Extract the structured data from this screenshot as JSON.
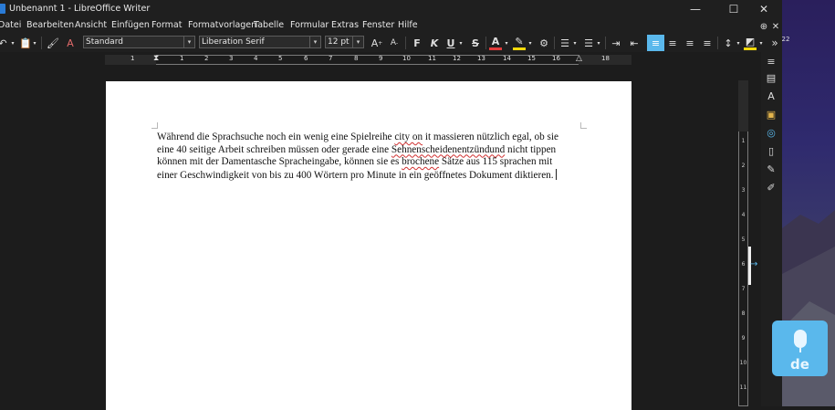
{
  "window": {
    "title": "Unbenannt 1 - LibreOffice Writer",
    "controls": [
      "—",
      "☐",
      "✕"
    ]
  },
  "menu": {
    "items": [
      "Datei",
      "Bearbeiten",
      "Ansicht",
      "Einfügen",
      "Format",
      "Formatvorlagen",
      "Tabelle",
      "Formular",
      "Extras",
      "Fenster",
      "Hilfe"
    ]
  },
  "toolbar": {
    "paragraph_style": "Standard",
    "font_name": "Liberation Serif",
    "font_size": "12 pt",
    "bold_label": "F",
    "italic_label": "K",
    "underline_label": "U",
    "strikethrough_label": "S",
    "overflow_label": "»",
    "overflow_number": "22"
  },
  "ruler": {
    "labels": [
      "1",
      "1",
      "2",
      "3",
      "4",
      "5",
      "6",
      "7",
      "8",
      "9",
      "10",
      "11",
      "12",
      "13",
      "14",
      "15",
      "16",
      "17",
      "18"
    ]
  },
  "vertical_ruler": {
    "labels": [
      "1",
      "2",
      "3",
      "4",
      "5",
      "6",
      "7",
      "8",
      "9",
      "10",
      "11",
      "12"
    ]
  },
  "document": {
    "lines": [
      [
        "Während die Sprachsuche noch ein wenig eine Spielreihe ",
        {
          "text": "city on",
          "error": true
        },
        " it massieren nützlich egal, ob sie"
      ],
      [
        "eine 40 seitige Arbeit schreiben müssen oder gerade eine ",
        {
          "text": "Sehnenscheidenentzündund",
          "error": true
        },
        " nicht tippen"
      ],
      [
        "können mit der Damentasche Spracheingabe, können sie es ",
        {
          "text": "brochene",
          "error": true
        },
        " Sätze aus 115 sprachen mit"
      ],
      [
        "einer Geschwindigkeit von bis zu 400 Wörtern pro Minute in ein geöffnetes Dokument diktieren."
      ]
    ]
  },
  "dictation": {
    "language": "de"
  },
  "colors": {
    "app_bg": "#1c1c1c",
    "page_bg": "#ffffff",
    "accent_blue": "#5ab8ec",
    "font_color_red": "#e23b3b",
    "highlight_yellow": "#f5d90a"
  }
}
